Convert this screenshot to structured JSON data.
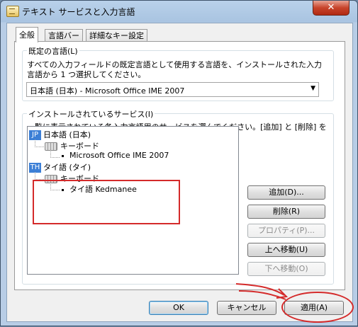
{
  "window": {
    "title": "テキスト サービスと入力言語",
    "close_glyph": "✕",
    "icon": "keyboard-app-icon"
  },
  "tabs": [
    {
      "label": "全般"
    },
    {
      "label": "言語バー"
    },
    {
      "label": "詳細なキー設定"
    }
  ],
  "default_language": {
    "group_label": "既定の言語(L)",
    "description": "すべての入力フィールドの既定言語として使用する言語を、インストールされた入力言語から 1 つ選択してください。",
    "selected": "日本語 (日本) - Microsoft Office IME 2007",
    "arrow_glyph": "▼"
  },
  "installed_services": {
    "group_label": "インストールされているサービス(I)",
    "description": "一覧に表示されている各入力言語用のサービスを選んでください。[追加] と [削除] を使って一覧を変更できます。",
    "tree": [
      {
        "badge": "JP",
        "language": "日本語 (日本)",
        "category": "キーボード",
        "service": "Microsoft Office IME 2007"
      },
      {
        "badge": "TH",
        "language": "タイ語 (タイ)",
        "category": "キーボード",
        "service": "タイ語 Kedmanee"
      }
    ]
  },
  "side_buttons": {
    "add": "追加(D)...",
    "remove": "削除(R)",
    "properties": "プロパティ(P)...",
    "move_up": "上へ移動(U)",
    "move_down": "下へ移動(O)"
  },
  "footer_buttons": {
    "ok": "OK",
    "cancel": "キャンセル",
    "apply": "適用(A)"
  },
  "colors": {
    "annotation": "#d42a2a",
    "badge": "#3c7fd6",
    "title_bar": "#b9d1ea"
  }
}
